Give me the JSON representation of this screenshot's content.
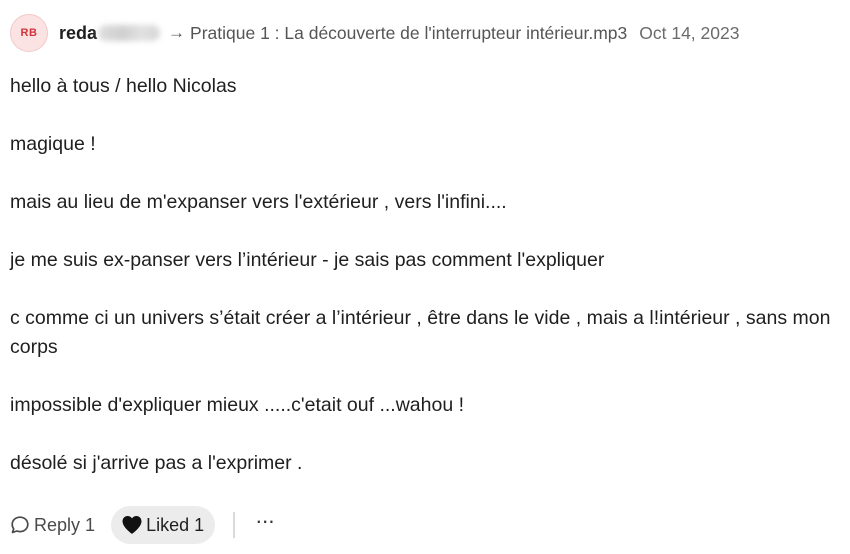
{
  "comment": {
    "avatar_initials": "RB",
    "author_name": "reda",
    "arrow": "→",
    "track_title": "Pratique 1 : La découverte de l'interrupteur intérieur.mp3",
    "date": "Oct 14, 2023",
    "paragraphs": [
      "hello à tous / hello Nicolas",
      "magique !",
      "mais au lieu de m'expanser vers l'extérieur , vers l'infini....",
      "je me suis ex-panser vers l’intérieur - je sais pas comment l'expliquer",
      "c comme ci un univers s’était créer a l’intérieur , être dans le vide , mais a l!intérieur , sans mon corps",
      "impossible d'expliquer mieux .....c'etait ouf ...wahou !",
      "désolé si j'arrive pas a l'exprimer ."
    ]
  },
  "actions": {
    "reply_label": "Reply",
    "reply_count": "1",
    "liked_label": "Liked",
    "liked_count": "1",
    "more_label": "···"
  },
  "icons": {
    "reply": "speech-bubble-icon",
    "like": "heart-icon"
  },
  "colors": {
    "avatar_bg": "#fbe3e3",
    "avatar_text": "#d0343c",
    "liked_bg": "#ececec"
  }
}
